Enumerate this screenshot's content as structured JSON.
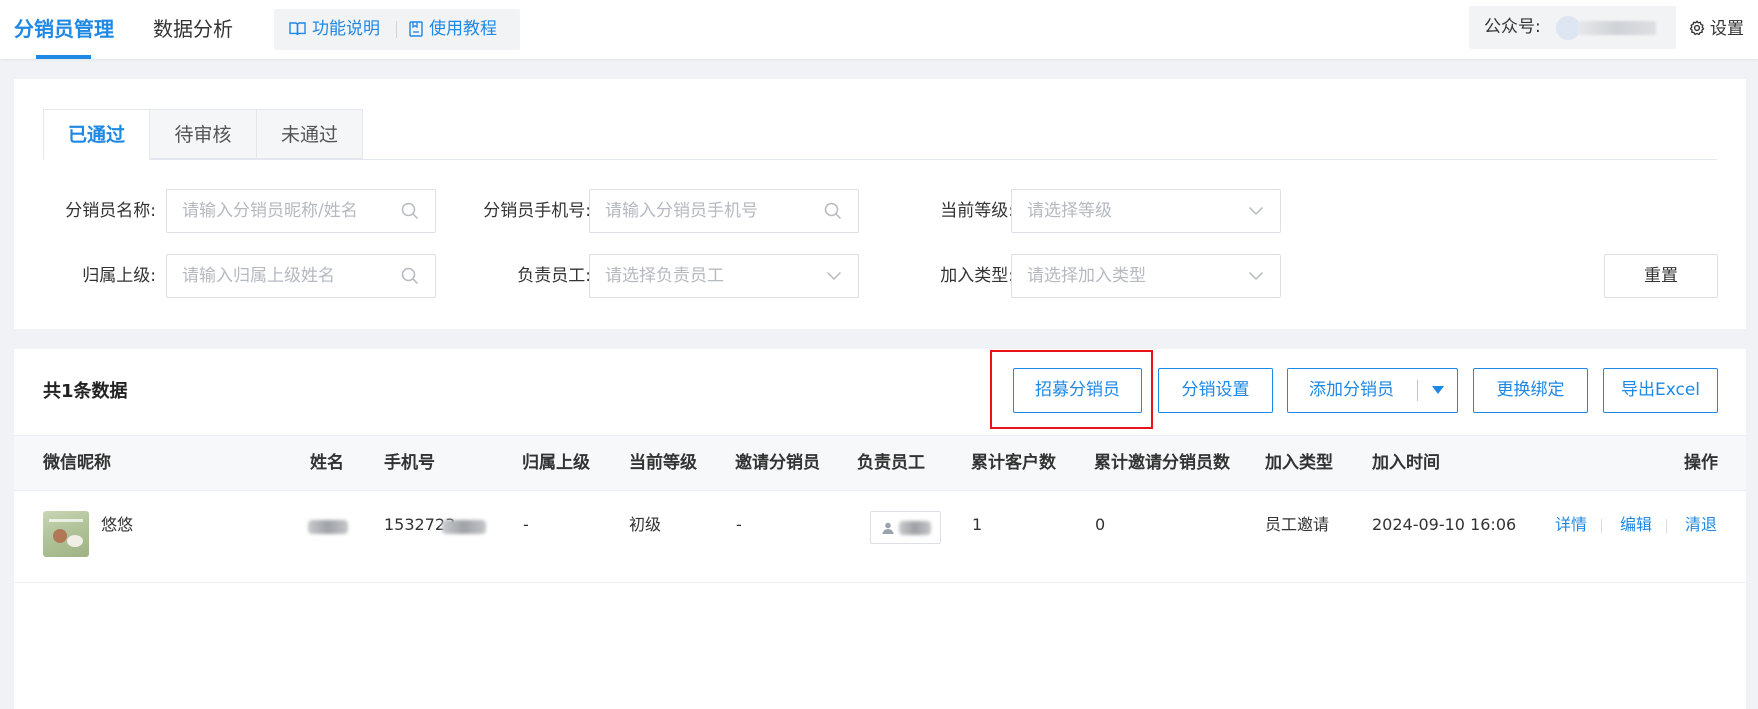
{
  "nav": {
    "tabs": [
      {
        "label": "分销员管理",
        "active": true
      },
      {
        "label": "数据分析",
        "active": false
      }
    ],
    "help_links": [
      {
        "label": "功能说明",
        "icon": "book-open-icon"
      },
      {
        "label": "使用教程",
        "icon": "document-icon"
      }
    ],
    "account_label": "公众号:",
    "settings_label": "设置"
  },
  "status_tabs": [
    {
      "label": "已通过",
      "active": true
    },
    {
      "label": "待审核",
      "active": false
    },
    {
      "label": "未通过",
      "active": false
    }
  ],
  "filters": {
    "distributor_name": {
      "label": "分销员名称:",
      "placeholder": "请输入分销员昵称/姓名"
    },
    "distributor_phone": {
      "label": "分销员手机号:",
      "placeholder": "请输入分销员手机号"
    },
    "current_level": {
      "label": "当前等级:",
      "placeholder": "请选择等级"
    },
    "superior": {
      "label": "归属上级:",
      "placeholder": "请输入归属上级姓名"
    },
    "staff": {
      "label": "负责员工:",
      "placeholder": "请选择负责员工"
    },
    "join_type": {
      "label": "加入类型:",
      "placeholder": "请选择加入类型"
    },
    "reset_label": "重置"
  },
  "toolbar": {
    "total_label": "共1条数据",
    "buttons": {
      "recruit": "招募分销员",
      "settings": "分销设置",
      "add": "添加分销员",
      "rebind": "更换绑定",
      "export": "导出Excel"
    }
  },
  "table": {
    "columns": [
      "微信昵称",
      "姓名",
      "手机号",
      "归属上级",
      "当前等级",
      "邀请分销员",
      "负责员工",
      "累计客户数",
      "累计邀请分销员数",
      "加入类型",
      "加入时间",
      "操作"
    ],
    "rows": [
      {
        "nickname": "悠悠",
        "phone": "1532723",
        "superior": "-",
        "level": "初级",
        "inviter": "-",
        "customers": "1",
        "invited": "0",
        "join_type": "员工邀请",
        "join_time": "2024-09-10 16:06",
        "actions": [
          "详情",
          "编辑",
          "清退"
        ]
      }
    ]
  },
  "colors": {
    "primary": "#1e88e5",
    "highlight": "#e8141a"
  }
}
